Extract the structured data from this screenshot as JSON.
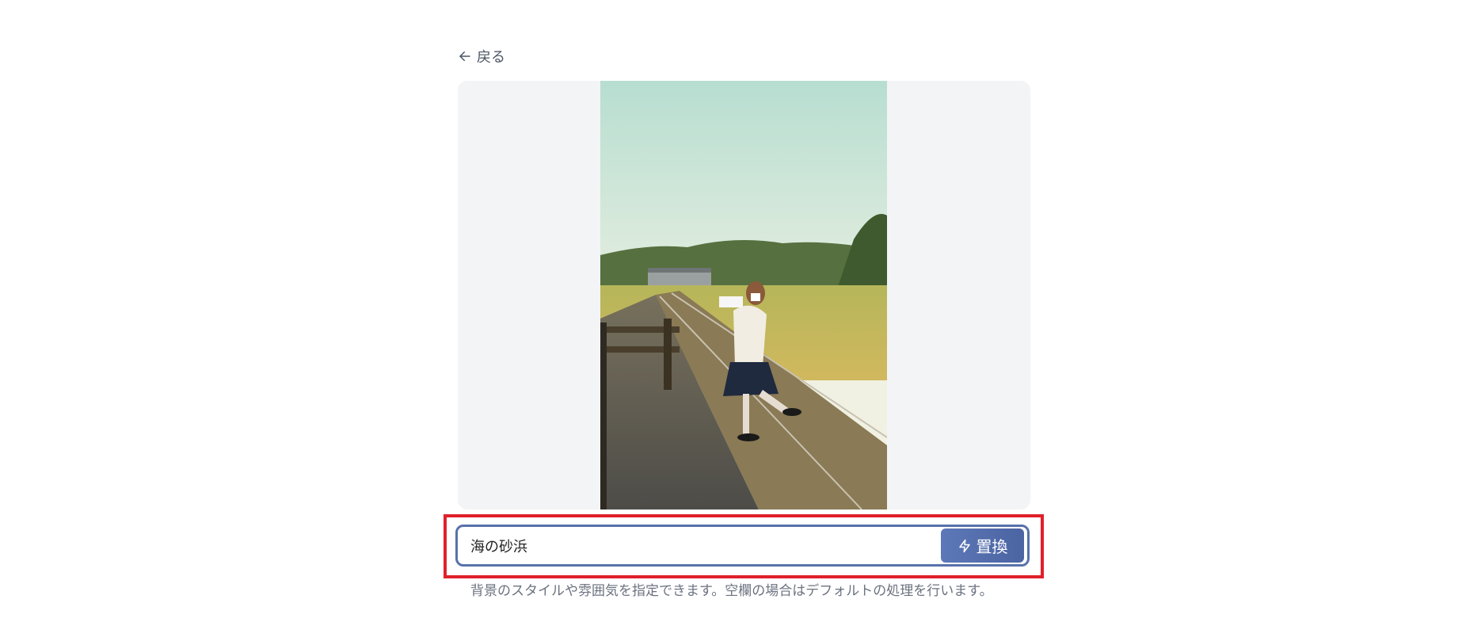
{
  "nav": {
    "back_label": "戻る"
  },
  "preview": {
    "image_alt": "photo of a schoolgirl on a railway platform"
  },
  "form": {
    "input_value": "海の砂浜",
    "button_label": "置換",
    "helper_text": "背景のスタイルや雰囲気を指定できます。空欄の場合はデフォルトの処理を行います。"
  },
  "colors": {
    "accent": "#4b64a2",
    "input_border": "#5872aa",
    "highlight_border": "#e0202b",
    "panel_background": "#f3f4f6"
  },
  "icons": {
    "back": "arrow-left-icon",
    "button": "lightning-icon"
  }
}
